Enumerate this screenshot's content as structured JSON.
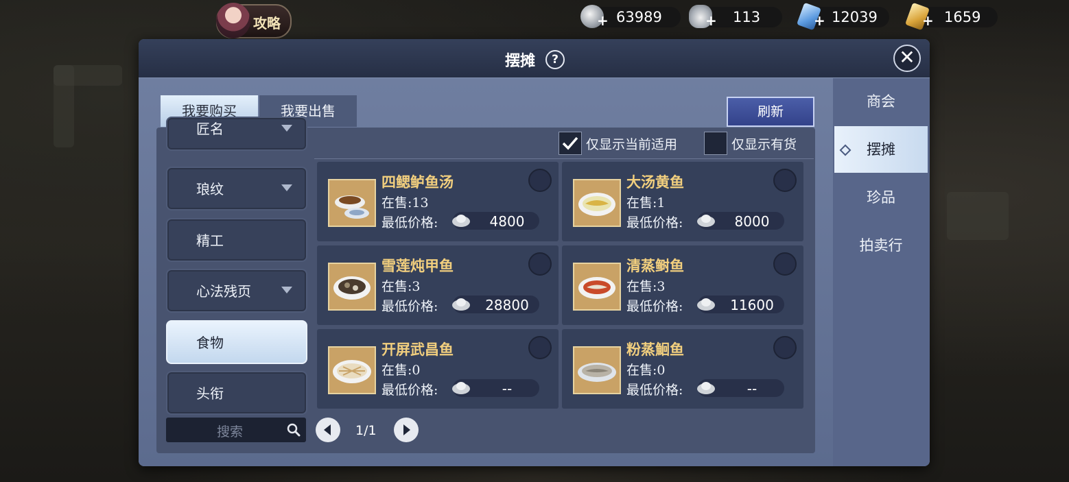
{
  "topbar": {
    "guide_label": "攻略",
    "currencies": [
      {
        "icon": "silver-coin-icon",
        "value": "63989"
      },
      {
        "icon": "silver-ingot-icon",
        "value": "113"
      },
      {
        "icon": "blue-ticket-icon",
        "value": "12039"
      },
      {
        "icon": "gold-ticket-icon",
        "value": "1659"
      }
    ]
  },
  "panel": {
    "title": "摆摊",
    "tabs": {
      "buy": "我要购买",
      "sell": "我要出售"
    },
    "refresh_label": "刷新",
    "filters": {
      "current_applicable": "仅显示当前适用",
      "in_stock": "仅显示有货"
    },
    "categories": [
      {
        "label": "匠名",
        "has_arrow": true
      },
      {
        "label": "琅纹",
        "has_arrow": true
      },
      {
        "label": "精工",
        "has_arrow": false
      },
      {
        "label": "心法残页",
        "has_arrow": true
      },
      {
        "label": "食物",
        "has_arrow": false,
        "active": true
      },
      {
        "label": "头衔",
        "has_arrow": false
      }
    ],
    "search_placeholder": "搜索",
    "pagination": "1/1",
    "price_label": "最低价格:",
    "items": [
      {
        "name": "四鳃鲈鱼汤",
        "stock": "在售:13",
        "price": "4800"
      },
      {
        "name": "大汤黄鱼",
        "stock": "在售:1",
        "price": "8000"
      },
      {
        "name": "雪莲炖甲鱼",
        "stock": "在售:3",
        "price": "28800"
      },
      {
        "name": "清蒸鲥鱼",
        "stock": "在售:3",
        "price": "11600"
      },
      {
        "name": "开屏武昌鱼",
        "stock": "在售:0",
        "price": "--"
      },
      {
        "name": "粉蒸鮰鱼",
        "stock": "在售:0",
        "price": "--"
      }
    ]
  },
  "sidenav": {
    "items": [
      "商会",
      "摆摊",
      "珍品",
      "拍卖行"
    ],
    "active_index": 1
  }
}
